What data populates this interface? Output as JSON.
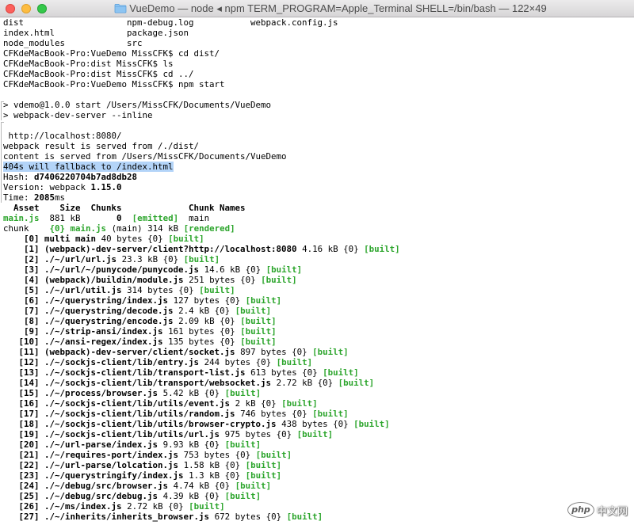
{
  "window": {
    "title": "VueDemo — node ◂ npm TERM_PROGRAM=Apple_Terminal SHELL=/bin/bash — 122×49",
    "icon": "folder-icon"
  },
  "colors": {
    "close": "#fc605c",
    "minimize": "#fdbc40",
    "zoom": "#34c84a",
    "text": "#000000",
    "green": "#2ca52c",
    "selection": "#b3d4f8",
    "background": "#ffffff"
  },
  "terminal": {
    "lines": [
      {
        "segments": [
          {
            "text": "dist                    npm-debug.log           webpack.config.js"
          }
        ]
      },
      {
        "segments": [
          {
            "text": "index.html              package.json"
          }
        ]
      },
      {
        "segments": [
          {
            "text": "node_modules            src"
          }
        ]
      },
      {
        "segments": [
          {
            "text": "CFKdeMacBook-Pro:VueDemo MissCFK$ cd dist/"
          }
        ]
      },
      {
        "segments": [
          {
            "text": "CFKdeMacBook-Pro:dist MissCFK$ ls"
          }
        ]
      },
      {
        "segments": [
          {
            "text": "CFKdeMacBook-Pro:dist MissCFK$ cd ../"
          }
        ]
      },
      {
        "segments": [
          {
            "text": "CFKdeMacBook-Pro:VueDemo MissCFK$ npm start"
          }
        ]
      },
      {
        "segments": []
      },
      {
        "mark": "start",
        "segments": [
          {
            "text": "> vdemo@1.0.0 start /Users/MissCFK/Documents/VueDemo"
          }
        ]
      },
      {
        "mark": "cont",
        "segments": [
          {
            "text": "> webpack-dev-server --inline"
          }
        ]
      },
      {
        "mark": "start",
        "segments": []
      },
      {
        "mark": "cont",
        "segments": [
          {
            "text": " http://localhost:8080/"
          }
        ]
      },
      {
        "mark": "cont",
        "segments": [
          {
            "text": "webpack result is served from /./dist/"
          }
        ]
      },
      {
        "mark": "cont",
        "segments": [
          {
            "text": "content is served from /Users/MissCFK/Documents/VueDemo"
          }
        ]
      },
      {
        "mark": "cont",
        "selected": true,
        "segments": [
          {
            "text": "404s will fallback to /index.html"
          }
        ]
      },
      {
        "mark": "cont",
        "segments": [
          {
            "text": "Hash: "
          },
          {
            "text": "d7406220704b7ad8db28",
            "style": "bold"
          }
        ]
      },
      {
        "mark": "cont",
        "segments": [
          {
            "text": "Version: webpack "
          },
          {
            "text": "1.15.0",
            "style": "bold"
          }
        ]
      },
      {
        "mark": "cont",
        "segments": [
          {
            "text": "Time: "
          },
          {
            "text": "2085",
            "style": "bold"
          },
          {
            "text": "ms"
          }
        ]
      },
      {
        "segments": [
          {
            "text": "  Asset    Size  Chunks             Chunk Names",
            "style": "bold"
          }
        ]
      },
      {
        "segments": [
          {
            "text": "main.js",
            "style": "green"
          },
          {
            "text": "  881 kB       "
          },
          {
            "text": "0",
            "style": "bold"
          },
          {
            "text": "  "
          },
          {
            "text": "[emitted]",
            "style": "green"
          },
          {
            "text": "  main"
          }
        ]
      },
      {
        "segments": [
          {
            "text": "chunk    "
          },
          {
            "text": "{0}",
            "style": "green"
          },
          {
            "text": " "
          },
          {
            "text": "main.js",
            "style": "green"
          },
          {
            "text": " (main) 314 kB "
          },
          {
            "text": "[rendered]",
            "style": "green"
          }
        ]
      }
    ],
    "modules": [
      {
        "id": "[0]",
        "path": "multi main",
        "size": "40 bytes",
        "chunk": "{0}",
        "status": "[built]"
      },
      {
        "id": "[1]",
        "path": "(webpack)-dev-server/client?http://localhost:8080",
        "size": "4.16 kB",
        "chunk": "{0}",
        "status": "[built]"
      },
      {
        "id": "[2]",
        "path": "./~/url/url.js",
        "size": "23.3 kB",
        "chunk": "{0}",
        "status": "[built]"
      },
      {
        "id": "[3]",
        "path": "./~/url/~/punycode/punycode.js",
        "size": "14.6 kB",
        "chunk": "{0}",
        "status": "[built]"
      },
      {
        "id": "[4]",
        "path": "(webpack)/buildin/module.js",
        "size": "251 bytes",
        "chunk": "{0}",
        "status": "[built]"
      },
      {
        "id": "[5]",
        "path": "./~/url/util.js",
        "size": "314 bytes",
        "chunk": "{0}",
        "status": "[built]"
      },
      {
        "id": "[6]",
        "path": "./~/querystring/index.js",
        "size": "127 bytes",
        "chunk": "{0}",
        "status": "[built]"
      },
      {
        "id": "[7]",
        "path": "./~/querystring/decode.js",
        "size": "2.4 kB",
        "chunk": "{0}",
        "status": "[built]"
      },
      {
        "id": "[8]",
        "path": "./~/querystring/encode.js",
        "size": "2.09 kB",
        "chunk": "{0}",
        "status": "[built]"
      },
      {
        "id": "[9]",
        "path": "./~/strip-ansi/index.js",
        "size": "161 bytes",
        "chunk": "{0}",
        "status": "[built]"
      },
      {
        "id": "[10]",
        "path": "./~/ansi-regex/index.js",
        "size": "135 bytes",
        "chunk": "{0}",
        "status": "[built]"
      },
      {
        "id": "[11]",
        "path": "(webpack)-dev-server/client/socket.js",
        "size": "897 bytes",
        "chunk": "{0}",
        "status": "[built]"
      },
      {
        "id": "[12]",
        "path": "./~/sockjs-client/lib/entry.js",
        "size": "244 bytes",
        "chunk": "{0}",
        "status": "[built]"
      },
      {
        "id": "[13]",
        "path": "./~/sockjs-client/lib/transport-list.js",
        "size": "613 bytes",
        "chunk": "{0}",
        "status": "[built]"
      },
      {
        "id": "[14]",
        "path": "./~/sockjs-client/lib/transport/websocket.js",
        "size": "2.72 kB",
        "chunk": "{0}",
        "status": "[built]"
      },
      {
        "id": "[15]",
        "path": "./~/process/browser.js",
        "size": "5.42 kB",
        "chunk": "{0}",
        "status": "[built]"
      },
      {
        "id": "[16]",
        "path": "./~/sockjs-client/lib/utils/event.js",
        "size": "2 kB",
        "chunk": "{0}",
        "status": "[built]"
      },
      {
        "id": "[17]",
        "path": "./~/sockjs-client/lib/utils/random.js",
        "size": "746 bytes",
        "chunk": "{0}",
        "status": "[built]"
      },
      {
        "id": "[18]",
        "path": "./~/sockjs-client/lib/utils/browser-crypto.js",
        "size": "438 bytes",
        "chunk": "{0}",
        "status": "[built]"
      },
      {
        "id": "[19]",
        "path": "./~/sockjs-client/lib/utils/url.js",
        "size": "975 bytes",
        "chunk": "{0}",
        "status": "[built]"
      },
      {
        "id": "[20]",
        "path": "./~/url-parse/index.js",
        "size": "9.93 kB",
        "chunk": "{0}",
        "status": "[built]"
      },
      {
        "id": "[21]",
        "path": "./~/requires-port/index.js",
        "size": "753 bytes",
        "chunk": "{0}",
        "status": "[built]"
      },
      {
        "id": "[22]",
        "path": "./~/url-parse/lolcation.js",
        "size": "1.58 kB",
        "chunk": "{0}",
        "status": "[built]"
      },
      {
        "id": "[23]",
        "path": "./~/querystringify/index.js",
        "size": "1.3 kB",
        "chunk": "{0}",
        "status": "[built]"
      },
      {
        "id": "[24]",
        "path": "./~/debug/src/browser.js",
        "size": "4.74 kB",
        "chunk": "{0}",
        "status": "[built]"
      },
      {
        "id": "[25]",
        "path": "./~/debug/src/debug.js",
        "size": "4.39 kB",
        "chunk": "{0}",
        "status": "[built]"
      },
      {
        "id": "[26]",
        "path": "./~/ms/index.js",
        "size": "2.72 kB",
        "chunk": "{0}",
        "status": "[built]"
      },
      {
        "id": "[27]",
        "path": "./~/inherits/inherits_browser.js",
        "size": "672 bytes",
        "chunk": "{0}",
        "status": "[built]"
      }
    ]
  },
  "watermark": {
    "logo": "php",
    "text": "中文网"
  }
}
